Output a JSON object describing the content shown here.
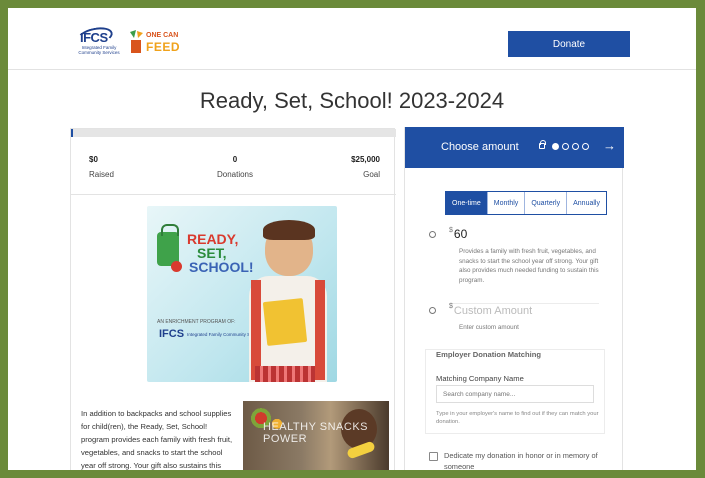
{
  "header": {
    "logo_ifcs": "IFCS",
    "logo_ifcs_sub": "Integrated Family Community Services",
    "logo_ocf_line1": "ONE CAN",
    "logo_ocf_line2": "FEED",
    "donate_label": "Donate"
  },
  "page": {
    "title": "Ready, Set, School! 2023-2024"
  },
  "campaign": {
    "progress_fraction": 0.005,
    "raised_value": "$0",
    "raised_label": "Raised",
    "donations_value": "0",
    "donations_label": "Donations",
    "goal_value": "$25,000",
    "goal_label": "Goal",
    "hero": {
      "line1": "READY,",
      "line2": "SET,",
      "line3": "SCHOOL!",
      "enrichment": "AN ENRICHMENT PROGRAM OF:",
      "logo": "IFCS",
      "logo_sub": "Integrated Family Community Services"
    },
    "description": "In addition to backpacks and school supplies for child(ren), the Ready, Set, School! program provides each family with fresh fruit, vegetables, and snacks to start the school year off strong. Your gift also sustains this program with much-needed funding.",
    "healthy_text": "HEALTHY SNACKS POWER"
  },
  "donation_panel": {
    "header_label": "Choose amount",
    "arrow": "→",
    "tabs": [
      "One-time",
      "Monthly",
      "Quarterly",
      "Annually"
    ],
    "option1": {
      "currency": "$",
      "amount": "60",
      "description": "Provides a family with fresh fruit, vegetables, and snacks to start the school year off strong. Your gift also provides much needed funding to sustain this program."
    },
    "option2": {
      "currency": "$",
      "placeholder": "Custom Amount",
      "helper": "Enter custom amount"
    },
    "employer": {
      "title": "Employer Donation Matching",
      "field_label": "Matching Company Name",
      "search_placeholder": "Search company name...",
      "help": "Type in your employer's name to find out if they can match your donation."
    },
    "dedicate_label": "Dedicate my donation in honor or in memory of someone"
  },
  "colors": {
    "brand_blue": "#1f4fa3",
    "frame_green": "#6b8a3a"
  }
}
